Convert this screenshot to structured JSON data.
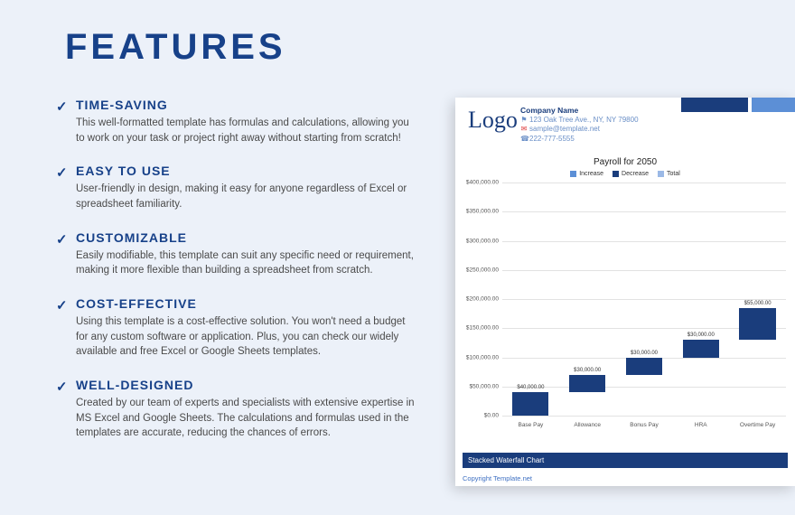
{
  "title": "FEATURES",
  "features": [
    {
      "heading": "TIME-SAVING",
      "body": "This well-formatted template has formulas and calculations, allowing you to work on your task or project right away without starting from scratch!"
    },
    {
      "heading": "EASY TO USE",
      "body": "User-friendly in design, making it easy for anyone regardless of Excel or spreadsheet familiarity."
    },
    {
      "heading": "CUSTOMIZABLE",
      "body": "Easily modifiable, this template can suit any specific need or requirement, making it more flexible than building a spreadsheet from scratch."
    },
    {
      "heading": "COST-EFFECTIVE",
      "body": "Using this template is a cost-effective solution. You won't need a budget for any custom software or application. Plus, you can check our widely available and free Excel or Google Sheets templates."
    },
    {
      "heading": "WELL-DESIGNED",
      "body": "Created by our team of experts and specialists with extensive expertise in MS Excel and Google Sheets. The calculations and formulas used in the templates are accurate, reducing the chances of errors."
    }
  ],
  "preview": {
    "logo_text": "Logo",
    "company": {
      "name": "Company Name",
      "address": "123 Oak Tree Ave., NY, NY 79800",
      "email": "sample@template.net",
      "phone": "222-777-5555"
    },
    "footer": "Stacked Waterfall Chart",
    "copyright": "Copyright Template.net"
  },
  "chart_data": {
    "type": "bar",
    "title": "Payroll for 2050",
    "legend": [
      "Increase",
      "Decrease",
      "Total"
    ],
    "legend_colors": [
      "#5c8fd6",
      "#1a3d7c",
      "#9bb9e6"
    ],
    "ylim": [
      0,
      400000
    ],
    "ytick_interval": 50000,
    "yticks": [
      0,
      50000,
      100000,
      150000,
      200000,
      250000,
      300000,
      350000,
      400000
    ],
    "ytick_labels": [
      "$0.00",
      "$50,000.00",
      "$100,000.00",
      "$150,000.00",
      "$200,000.00",
      "$250,000.00",
      "$300,000.00",
      "$350,000.00",
      "$400,000.00"
    ],
    "categories": [
      "Base Pay",
      "Allowance",
      "Bonus Pay",
      "HRA",
      "Overtime Pay"
    ],
    "bars": [
      {
        "label": "$40,000.00",
        "start": 0,
        "end": 40000
      },
      {
        "label": "$30,000.00",
        "start": 40000,
        "end": 70000
      },
      {
        "label": "$30,000.00",
        "start": 70000,
        "end": 100000
      },
      {
        "label": "$30,000.00",
        "start": 100000,
        "end": 130000
      },
      {
        "label": "$55,000.00",
        "start": 130000,
        "end": 185000
      }
    ]
  }
}
